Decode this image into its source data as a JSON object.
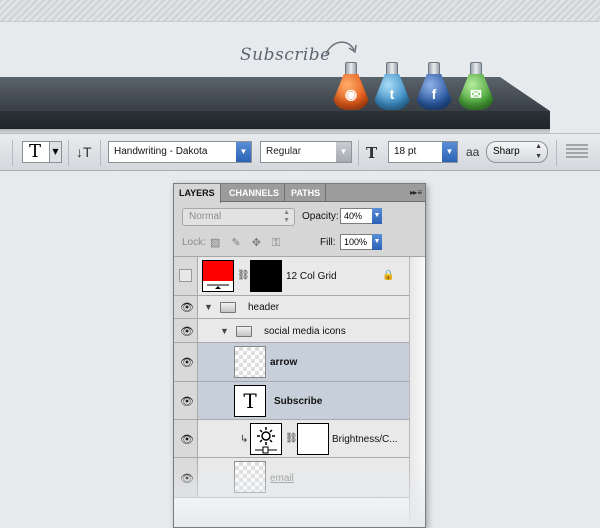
{
  "header": {
    "subscribe_text": "Subscribe",
    "social_icons": [
      {
        "name": "rss",
        "glyph": "◉",
        "color": "#e35b1b"
      },
      {
        "name": "twitter",
        "glyph": "t",
        "color": "#3d8fc7"
      },
      {
        "name": "facebook",
        "glyph": "f",
        "color": "#2c5aa3"
      },
      {
        "name": "email",
        "glyph": "✉",
        "color": "#4ca53a"
      }
    ]
  },
  "toolbar": {
    "tool_glyph": "T",
    "orientation_glyph": "↓T",
    "font_family": "Handwriting - Dakota",
    "font_style": "Regular",
    "size_glyph": "T",
    "font_size": "18 pt",
    "aa_glyph": "aa",
    "antialias": "Sharp"
  },
  "layers_panel": {
    "tabs": [
      "LAYERS",
      "CHANNELS",
      "PATHS"
    ],
    "menu_glyph": "▸▸ ≡",
    "blend_mode": "Normal",
    "opacity_label": "Opacity:",
    "opacity_value": "40%",
    "lock_label": "Lock:",
    "lock_glyphs": "▨ ✎ ✥ ⚿",
    "fill_label": "Fill:",
    "fill_value": "100%",
    "layers": [
      {
        "name": "12 Col Grid",
        "type": "raster-mask",
        "visible": false,
        "locked": true
      },
      {
        "name": "header",
        "type": "group"
      },
      {
        "name": "social media icons",
        "type": "group"
      },
      {
        "name": "arrow",
        "type": "raster"
      },
      {
        "name": "Subscribe",
        "type": "text"
      },
      {
        "name": "Brightness/C...",
        "type": "adjustment"
      },
      {
        "name": "email",
        "type": "raster"
      }
    ]
  }
}
